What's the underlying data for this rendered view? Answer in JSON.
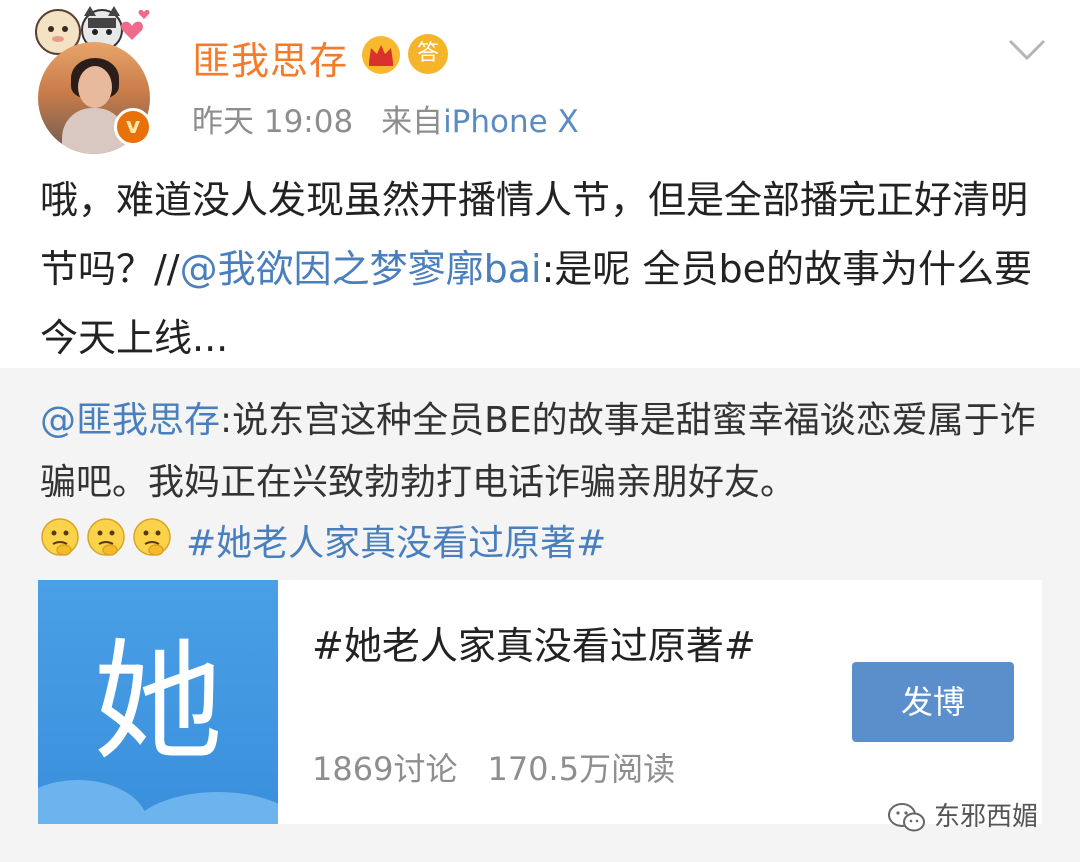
{
  "post": {
    "username": "匪我思存",
    "qa_badge": "答",
    "time": "昨天 19:08",
    "source_prefix": "来自",
    "device": "iPhone X",
    "verified_badge": "v",
    "text_part1": "哦，难道没人发现虽然开播情人节，但是全部播完正好清明节吗？//",
    "mention": "@我欲因之梦寥廓bai",
    "text_part2": ":是呢 全员be的故事为什么要今天上线..."
  },
  "quote": {
    "mention": "@匪我思存",
    "text": ":说东宫这种全员BE的故事是甜蜜幸福谈恋爱属于诈骗吧。我妈正在兴致勃勃打电话诈骗亲朋好友。",
    "emoji_icon": "thinking-face-emoji",
    "hashtag": "#她老人家真没看过原著#"
  },
  "card": {
    "image_char": "她",
    "title": "#她老人家真没看过原著#",
    "discussions": "1869讨论",
    "reads": "170.5万阅读",
    "button_label": "发博"
  },
  "watermark": {
    "text": "东邪西媚",
    "icon": "wechat-icon"
  },
  "colors": {
    "username": "#f47a2c",
    "link": "#4a7fbd",
    "button": "#5b8fcc",
    "quote_bg": "#f4f4f4",
    "topic_image": "#3a8fdc"
  }
}
